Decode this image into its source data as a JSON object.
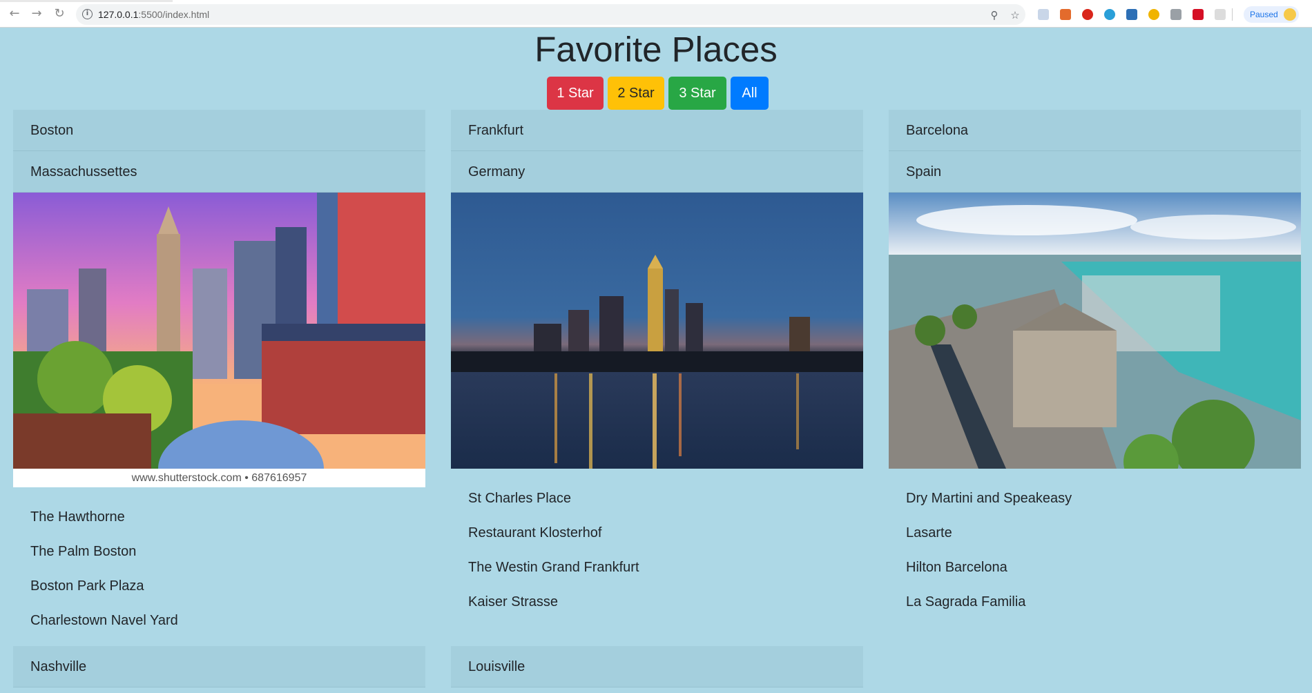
{
  "browser": {
    "url_host": "127.0.0.1",
    "url_path": ":5500/index.html",
    "profile_label": "Paused"
  },
  "page": {
    "title": "Favorite Places"
  },
  "filters": [
    {
      "label": "1 Star",
      "color": "#dc3545"
    },
    {
      "label": "2 Star",
      "color": "#ffc107"
    },
    {
      "label": "3 Star",
      "color": "#28a745"
    },
    {
      "label": "All",
      "color": "#007bff"
    }
  ],
  "places": [
    {
      "city": "Boston",
      "region": "Massachussettes",
      "image_caption": "www.shutterstock.com • 687616957",
      "spots": [
        "The Hawthorne",
        "The Palm Boston",
        "Boston Park Plaza",
        "Charlestown Navel Yard"
      ]
    },
    {
      "city": "Frankfurt",
      "region": "Germany",
      "spots": [
        "St Charles Place",
        "Restaurant Klosterhof",
        "The Westin Grand Frankfurt",
        "Kaiser Strasse"
      ]
    },
    {
      "city": "Barcelona",
      "region": "Spain",
      "spots": [
        "Dry Martini and Speakeasy",
        "Lasarte",
        "Hilton Barcelona",
        "La Sagrada Familia"
      ]
    },
    {
      "city": "Nashville"
    },
    {
      "city": "Louisville"
    }
  ]
}
